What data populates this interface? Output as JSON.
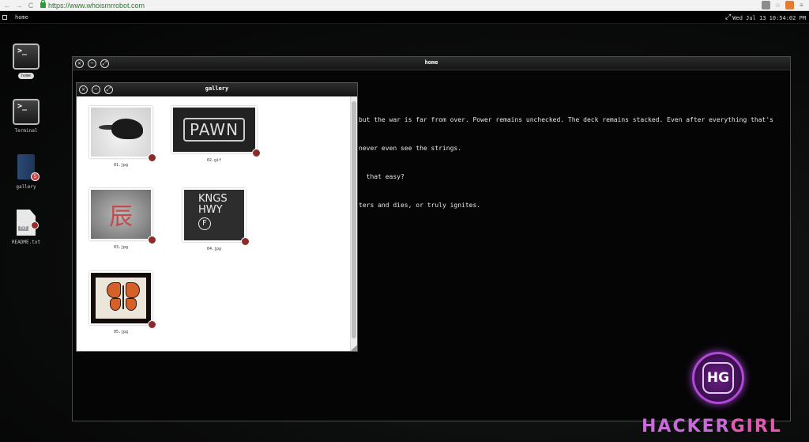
{
  "browser": {
    "url": "https://www.whoismrrobot.com",
    "back": "←",
    "forward": "→",
    "reload": "C"
  },
  "topbar": {
    "home_label": "home",
    "clock": "Wed Jul 13 10:54:02 PM",
    "fullscreen_icon": "⤢"
  },
  "desktop_icons": [
    {
      "label": "home",
      "icon": "terminal-icon",
      "glyph": ">_"
    },
    {
      "label": "Terminal",
      "icon": "terminal-icon",
      "glyph": ">_"
    },
    {
      "label": "gallery",
      "icon": "folder-icon",
      "badge": "5"
    },
    {
      "label": "README.txt",
      "icon": "text-file-icon",
      "tag": "TXT"
    }
  ],
  "home_window": {
    "title": "home",
    "lines": [
      "but the war is far from over. Power remains unchecked. The deck remains stacked. Even after everything that's",
      "never even see the strings.",
      "  that easy?",
      "ters and dies, or truly ignites."
    ]
  },
  "gallery_window": {
    "title": "gallery",
    "items": [
      {
        "filename": "01.jpg",
        "content": "bird"
      },
      {
        "filename": "02.gif",
        "content": "PAWN"
      },
      {
        "filename": "03.jpg",
        "content": "辰"
      },
      {
        "filename": "04.jpg",
        "content": [
          "KNGS",
          "HWY",
          "F"
        ]
      },
      {
        "filename": "05.jpg",
        "content": "butterfly"
      }
    ]
  },
  "window_buttons": {
    "close": "✕",
    "minimize": "−",
    "maximize": "⤢"
  },
  "watermark": {
    "logo": "HG",
    "text_a": "HACKER",
    "text_b": "GIRL"
  }
}
